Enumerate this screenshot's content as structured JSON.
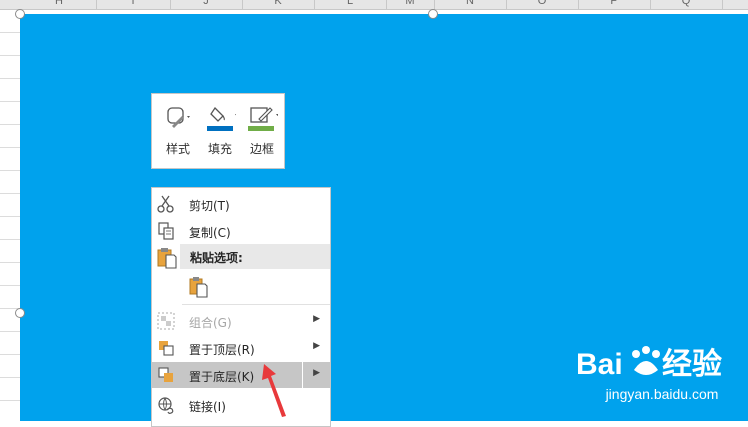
{
  "spreadsheet": {
    "columns": [
      "H",
      "I",
      "J",
      "K",
      "L",
      "M",
      "N",
      "O",
      "P",
      "Q"
    ]
  },
  "mini_toolbar": {
    "buttons": [
      {
        "label": "样式",
        "icon": "shape-style-icon"
      },
      {
        "label": "填充",
        "icon": "fill-bucket-icon",
        "color": "#0070c0"
      },
      {
        "label": "边框",
        "icon": "outline-pen-icon",
        "color": "#70ad47"
      }
    ]
  },
  "context_menu": {
    "items": [
      {
        "label": "剪切(T)",
        "icon": "scissors-icon"
      },
      {
        "label": "复制(C)",
        "icon": "copy-icon"
      },
      {
        "section_header": "粘贴选项:",
        "icon": "clipboard-icon"
      },
      {
        "paste_option_icon": "paste-keep-format-icon"
      },
      {
        "label": "组合(G)",
        "icon": "group-icon",
        "disabled": true,
        "submenu": true
      },
      {
        "label": "置于顶层(R)",
        "icon": "bring-to-front-icon",
        "submenu": true
      },
      {
        "label": "置于底层(K)",
        "icon": "send-to-back-icon",
        "submenu": true,
        "highlighted": true
      },
      {
        "label": "链接(I)",
        "icon": "link-icon"
      }
    ]
  },
  "colors": {
    "shape_fill": "#00a2ed",
    "highlight": "#c6c6c6",
    "pointer_arrow": "#e8393b"
  },
  "watermark": {
    "brand": "Bai du 经验",
    "url": "jingyan.baidu.com"
  }
}
